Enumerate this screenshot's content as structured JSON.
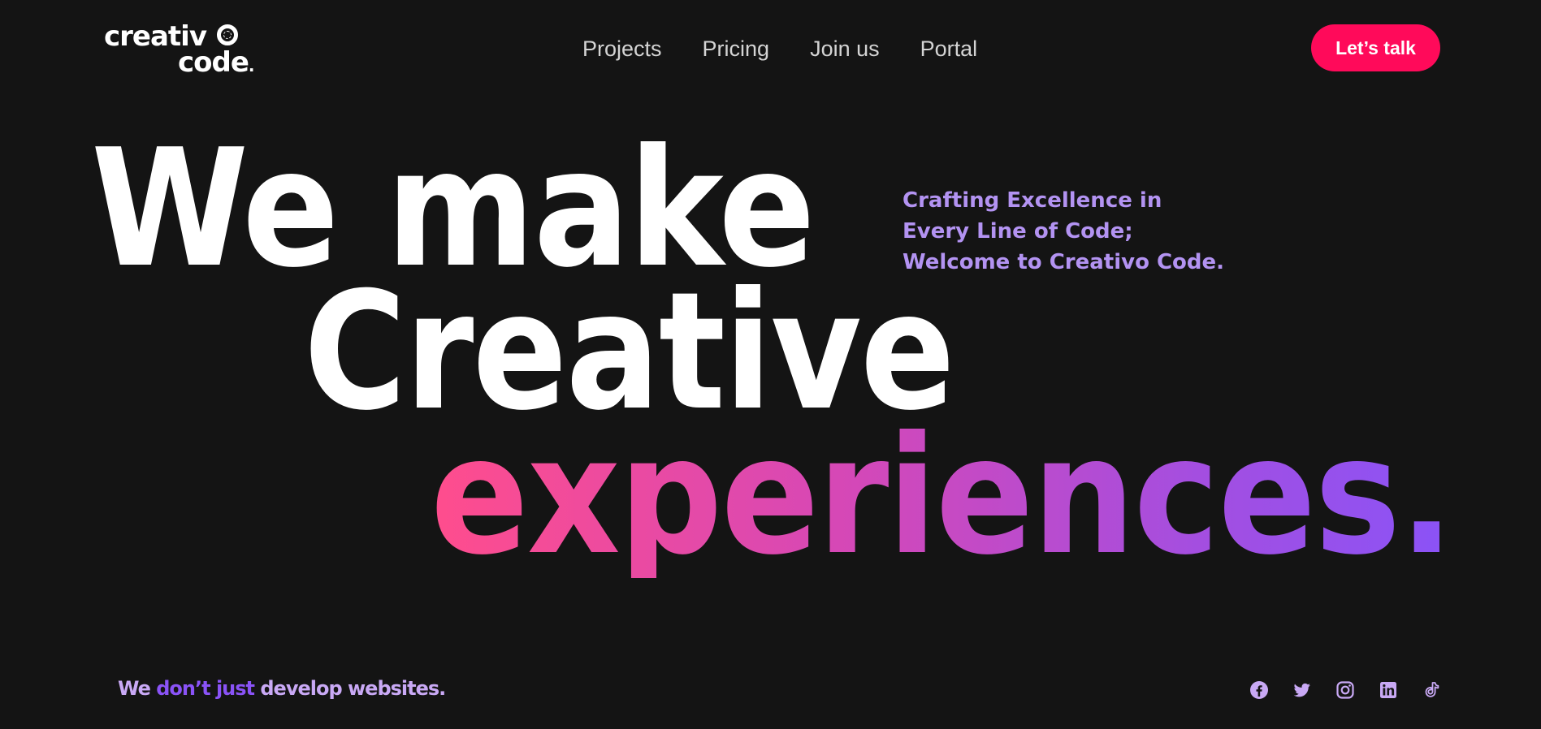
{
  "header": {
    "logo": {
      "line1": "creativ",
      "line2": "code",
      "dot": "."
    },
    "nav": [
      {
        "label": "Projects"
      },
      {
        "label": "Pricing"
      },
      {
        "label": "Join us"
      },
      {
        "label": "Portal"
      }
    ],
    "cta_label": "Let’s talk"
  },
  "hero": {
    "line1": "We make",
    "line2": "Creative",
    "line3": "experiences.",
    "tagline": [
      "Crafting Excellence in",
      "Every Line of Code;",
      "Welcome to Creativo Code."
    ]
  },
  "footer": {
    "sub_parts": {
      "part1": "We ",
      "part2": "don’t just ",
      "part3": "develop websites."
    },
    "socials": [
      {
        "icon": "facebook-icon"
      },
      {
        "icon": "twitter-icon"
      },
      {
        "icon": "instagram-icon"
      },
      {
        "icon": "linkedin-icon"
      },
      {
        "icon": "tiktok-icon"
      }
    ]
  },
  "colors": {
    "background": "#141414",
    "cta": "#ff0a5a",
    "tagline": "#b393f2",
    "gradient_start": "#ff4d8d",
    "gradient_end": "#8a53f7"
  }
}
